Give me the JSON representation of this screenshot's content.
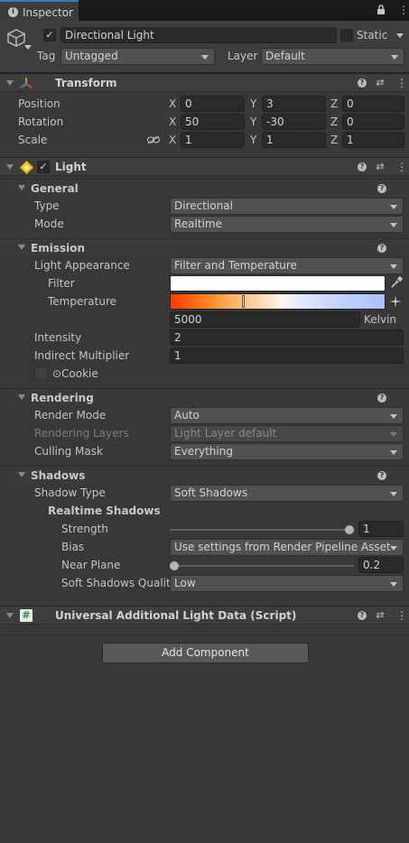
{
  "tab": {
    "label": "Inspector"
  },
  "header": {
    "object_name": "Directional Light",
    "static_label": "Static",
    "tag_label": "Tag",
    "tag_value": "Untagged",
    "layer_label": "Layer",
    "layer_value": "Default"
  },
  "transform": {
    "title": "Transform",
    "position_label": "Position",
    "rotation_label": "Rotation",
    "scale_label": "Scale",
    "axis_x": "X",
    "axis_y": "Y",
    "axis_z": "Z",
    "position": {
      "x": "0",
      "y": "3",
      "z": "0"
    },
    "rotation": {
      "x": "50",
      "y": "-30",
      "z": "0"
    },
    "scale": {
      "x": "1",
      "y": "1",
      "z": "1"
    }
  },
  "light": {
    "title": "Light",
    "general": {
      "title": "General",
      "type_label": "Type",
      "type_value": "Directional",
      "mode_label": "Mode",
      "mode_value": "Realtime"
    },
    "emission": {
      "title": "Emission",
      "appearance_label": "Light Appearance",
      "appearance_value": "Filter and Temperature",
      "filter_label": "Filter",
      "temperature_label": "Temperature",
      "temperature_value": "5000",
      "temperature_unit": "Kelvin",
      "intensity_label": "Intensity",
      "intensity_value": "2",
      "indirect_label": "Indirect Multiplier",
      "indirect_value": "1",
      "cookie_label": "Cookie"
    },
    "rendering": {
      "title": "Rendering",
      "render_mode_label": "Render Mode",
      "render_mode_value": "Auto",
      "layers_label": "Rendering Layers",
      "layers_value": "Light Layer default",
      "culling_label": "Culling Mask",
      "culling_value": "Everything"
    },
    "shadows": {
      "title": "Shadows",
      "type_label": "Shadow Type",
      "type_value": "Soft Shadows",
      "realtime_label": "Realtime Shadows",
      "strength_label": "Strength",
      "strength_value": "1",
      "strength_level": 1.0,
      "bias_label": "Bias",
      "bias_value": "Use settings from Render Pipeline Asset",
      "near_label": "Near Plane",
      "near_value": "0.2",
      "near_level": 0.0,
      "quality_label": "Soft Shadows Quality",
      "quality_value": "Low"
    }
  },
  "script_component": {
    "title": "Universal Additional Light Data (Script)"
  },
  "add_component": {
    "label": "Add Component"
  },
  "colors": {
    "accent": "#3a79bb",
    "panel": "#383838",
    "header": "#3e3e3e"
  }
}
